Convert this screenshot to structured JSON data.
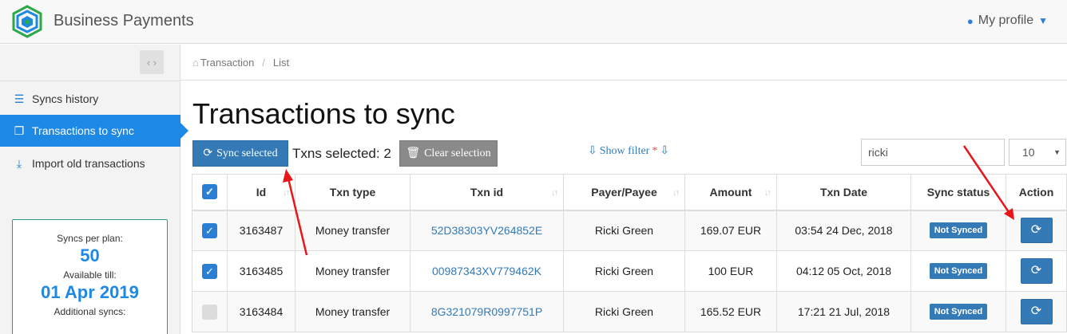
{
  "header": {
    "app_title": "Business Payments",
    "profile_label": "My profile",
    "logo_icon": "hexagon-logo-icon",
    "accent_color": "#1e88e5"
  },
  "sidebar": {
    "collapse_icon": "chevron-left-right-icon",
    "items": [
      {
        "label": "Syncs history",
        "icon": "list-icon",
        "active": false
      },
      {
        "label": "Transactions to sync",
        "icon": "copy-icon",
        "active": true
      },
      {
        "label": "Import old transactions",
        "icon": "download-icon",
        "active": false
      }
    ],
    "plan": {
      "syncs_per_plan_label": "Syncs per plan:",
      "syncs_per_plan_value": "50",
      "available_till_label": "Available till:",
      "available_till_value": "01 Apr 2019",
      "additional_syncs_label": "Additional syncs:"
    }
  },
  "breadcrumb": {
    "items": [
      "Transaction",
      "List"
    ],
    "separator": "/"
  },
  "main": {
    "title": "Transactions to sync",
    "sync_button_label": "Sync selected",
    "selected_text": "Txns selected: 2",
    "clear_button_label": "Clear selection",
    "show_filter_label": "Show filter",
    "show_filter_marker": "*",
    "search_value": "ricki",
    "page_size": "10"
  },
  "table": {
    "columns": [
      "Id",
      "Txn type",
      "Txn id",
      "Payer/Payee",
      "Amount",
      "Txn Date",
      "Sync status",
      "Action"
    ],
    "rows": [
      {
        "checked": true,
        "id": "3163487",
        "txn_type": "Money transfer",
        "txn_id": "52D38303YV264852E",
        "payer": "Ricki Green",
        "amount": "169.07 EUR",
        "date": "03:54 24 Dec, 2018",
        "status": "Not Synced"
      },
      {
        "checked": true,
        "id": "3163485",
        "txn_type": "Money transfer",
        "txn_id": "00987343XV779462K",
        "payer": "Ricki Green",
        "amount": "100 EUR",
        "date": "04:12 05 Oct, 2018",
        "status": "Not Synced"
      },
      {
        "checked": false,
        "id": "3163484",
        "txn_type": "Money transfer",
        "txn_id": "8G321079R0997751P",
        "payer": "Ricki Green",
        "amount": "165.52 EUR",
        "date": "17:21 21 Jul, 2018",
        "status": "Not Synced"
      }
    ]
  }
}
